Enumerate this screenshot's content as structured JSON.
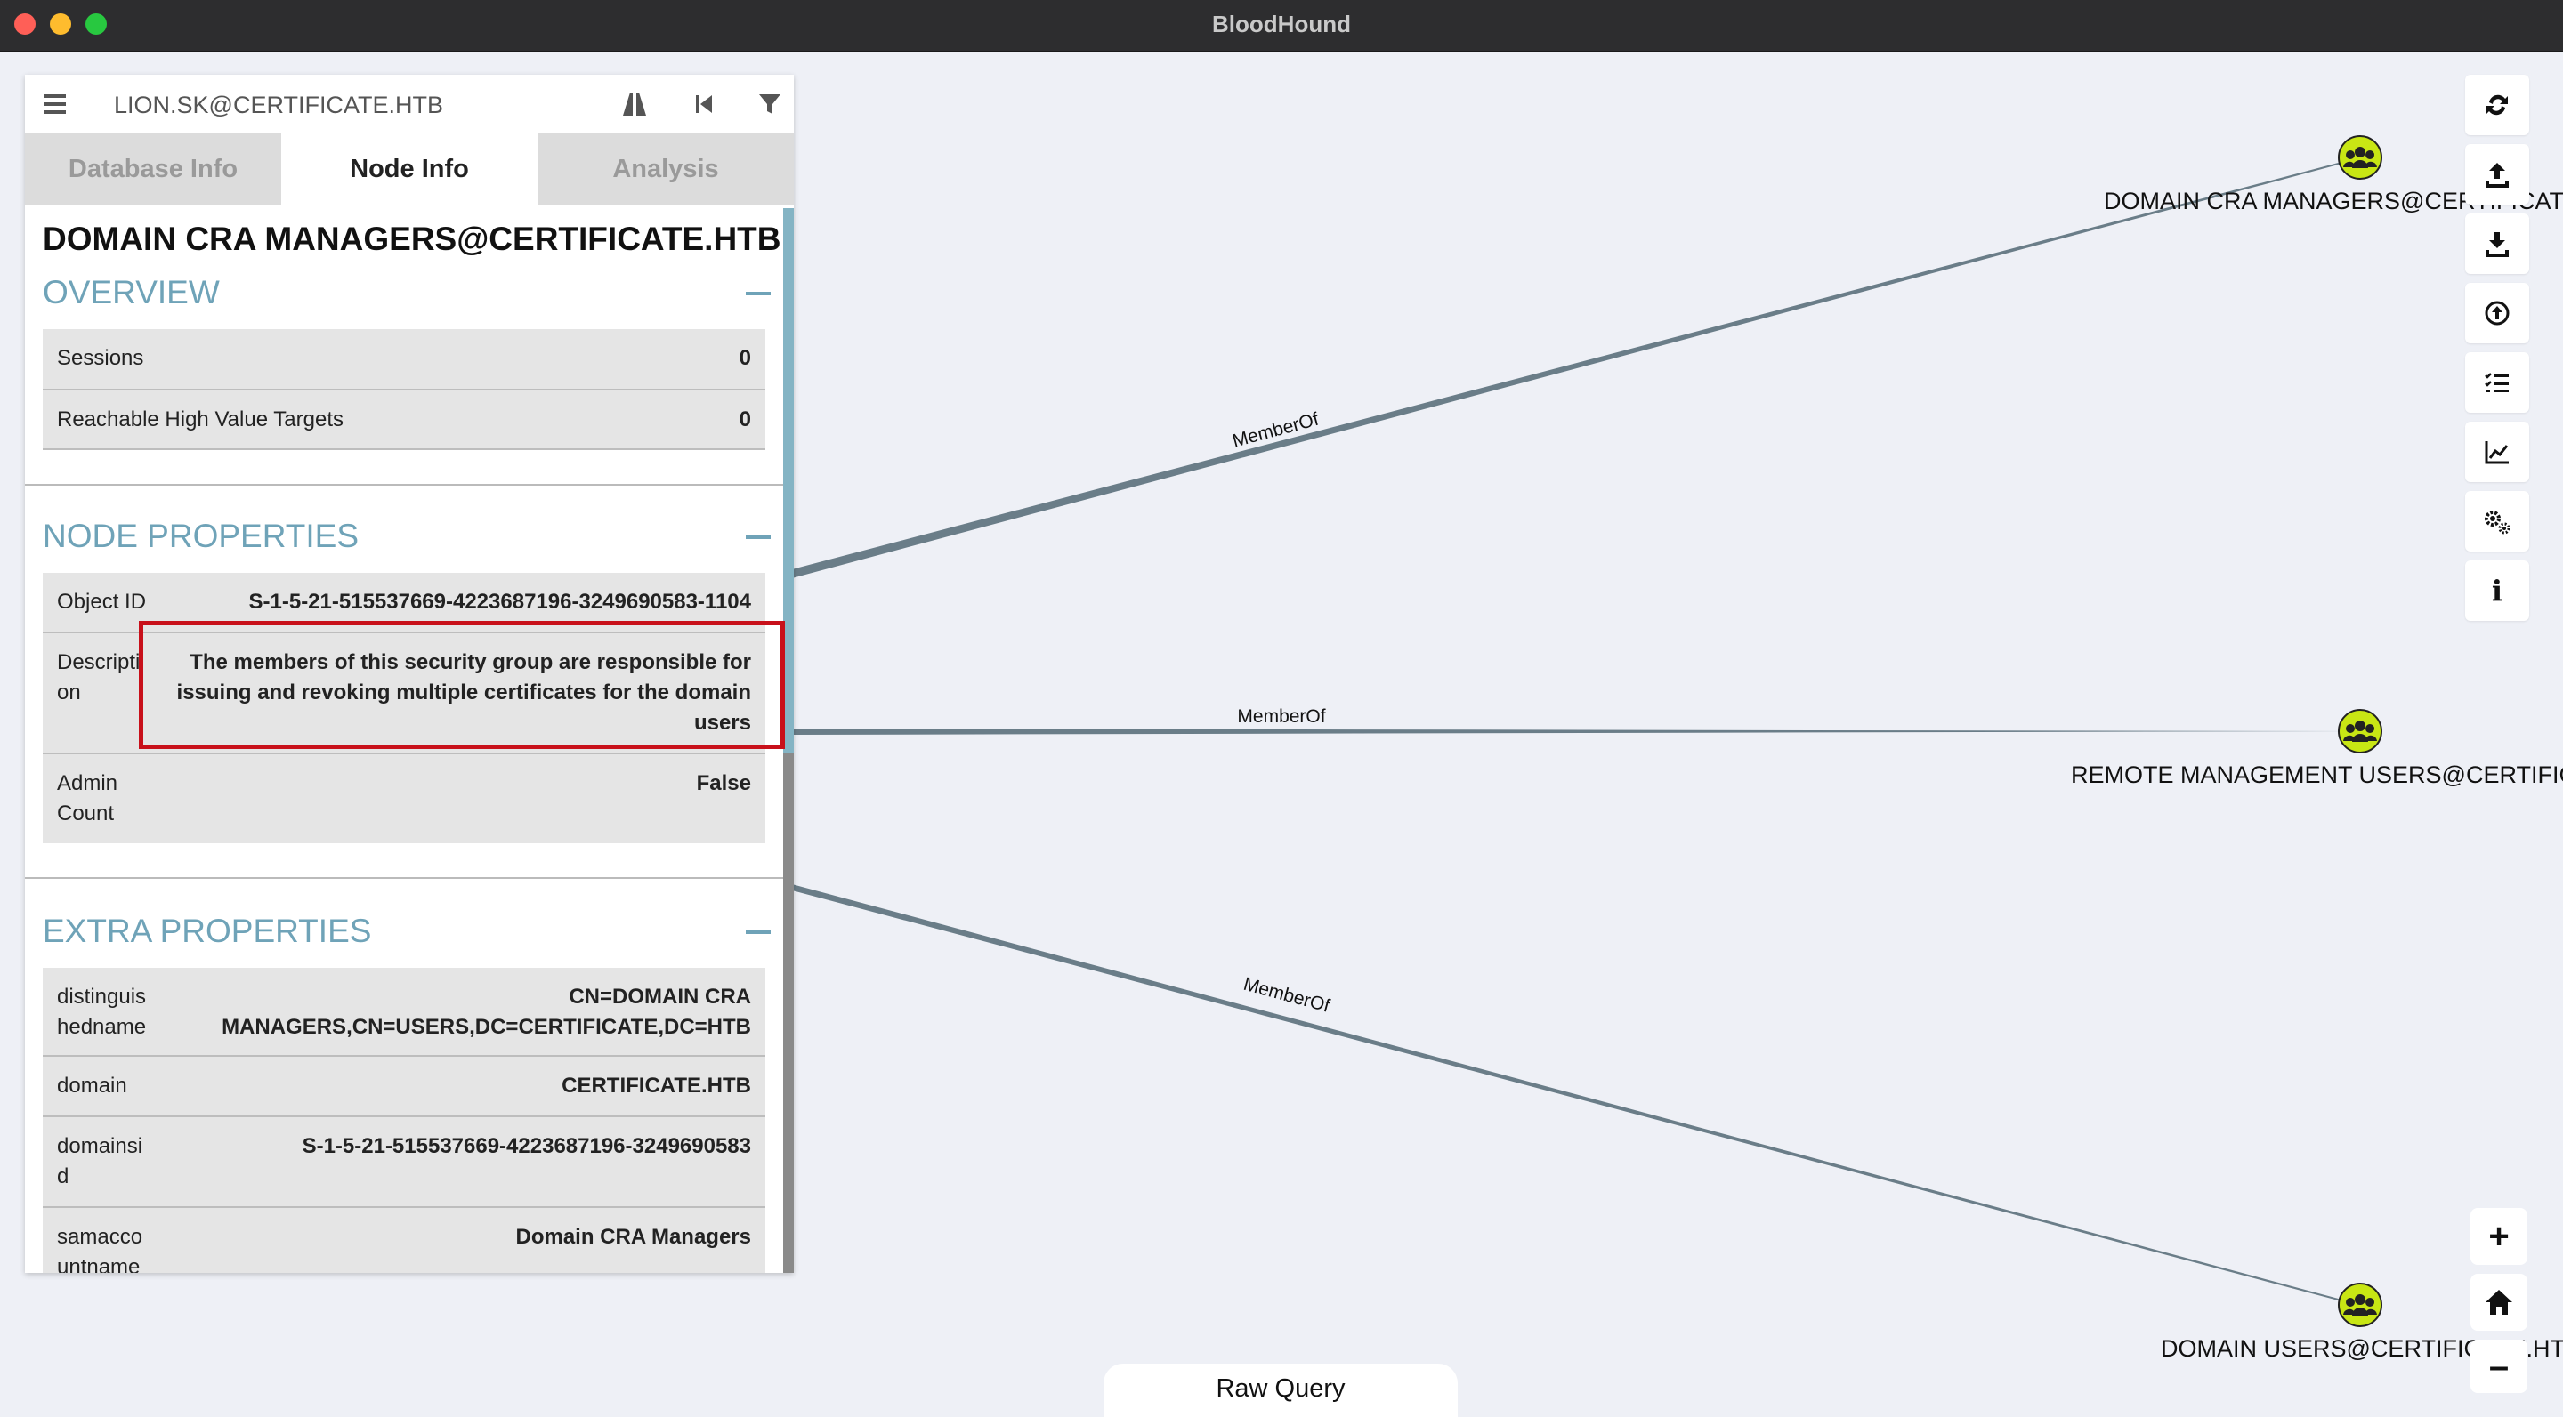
{
  "window": {
    "title": "BloodHound"
  },
  "search": {
    "value": "LION.SK@CERTIFICATE.HTB"
  },
  "tabs": [
    {
      "label": "Database Info"
    },
    {
      "label": "Node Info"
    },
    {
      "label": "Analysis"
    }
  ],
  "node": {
    "title": "DOMAIN CRA MANAGERS@CERTIFICATE.HTB",
    "overview": {
      "heading": "OVERVIEW",
      "rows": [
        {
          "key": "Sessions",
          "value": "0"
        },
        {
          "key": "Reachable High Value Targets",
          "value": "0"
        }
      ]
    },
    "node_properties": {
      "heading": "NODE PROPERTIES",
      "rows": [
        {
          "key": "Object ID",
          "value": "S-1-5-21-515537669-4223687196-3249690583-1104"
        },
        {
          "key": "Descripti on",
          "value": "The members of this security group are responsible for issuing and revoking multiple certificates for the domain users"
        },
        {
          "key": "Admin Count",
          "value": "False"
        }
      ]
    },
    "extra_properties": {
      "heading": "EXTRA PROPERTIES",
      "rows": [
        {
          "key": "distinguis hedname",
          "value": "CN=DOMAIN CRA MANAGERS,CN=USERS,DC=CERTIFICATE,DC=HTB"
        },
        {
          "key": "domain",
          "value": "CERTIFICATE.HTB"
        },
        {
          "key": "domainsi d",
          "value": "S-1-5-21-515537669-4223687196-3249690583"
        },
        {
          "key": "samacco untname",
          "value": "Domain CRA Managers"
        }
      ]
    }
  },
  "graph": {
    "nodes": [
      {
        "label": "DOMAIN CRA MANAGERS@CERTIFICATE.HTB",
        "icon": "group-icon"
      },
      {
        "label": "REMOTE MANAGEMENT USERS@CERTIFICATE.HTB",
        "icon": "group-icon"
      },
      {
        "label": "DOMAIN USERS@CERTIFICATE.HTB",
        "icon": "group-icon"
      }
    ],
    "edges": [
      {
        "label": "MemberOf"
      },
      {
        "label": "MemberOf"
      },
      {
        "label": "MemberOf"
      }
    ]
  },
  "toolbar": {
    "buttons": [
      "refresh-icon",
      "upload-icon",
      "download-icon",
      "upload-circle-icon",
      "query-list-icon",
      "chart-icon",
      "settings-icon",
      "info-icon"
    ],
    "info_label": "i"
  },
  "zoom": {
    "in": "+",
    "home": "home-icon",
    "out": "–"
  },
  "raw_query": {
    "label": "Raw Query"
  },
  "colors": {
    "accent": "#6fa3b8",
    "highlight": "#c8101a",
    "node_icon": "#c8e614",
    "edge": "#6a7d88"
  }
}
